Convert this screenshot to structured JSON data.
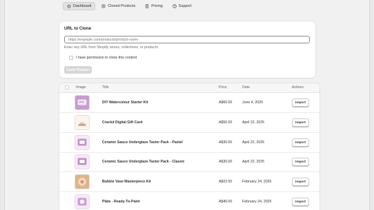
{
  "nav": {
    "tabs": [
      {
        "label": "Dashboard",
        "icon": "home-icon",
        "active": true
      },
      {
        "label": "Cloned Products",
        "icon": "products-icon",
        "active": false
      },
      {
        "label": "Pricing",
        "icon": "pricing-icon",
        "active": false
      },
      {
        "label": "Support",
        "icon": "help-icon",
        "active": false
      }
    ]
  },
  "clone_form": {
    "title": "URL to Clone",
    "url_placeholder": "https://example.com/products/product-name",
    "help_text": "Enter any URL from Shopify stores, collections, or products.",
    "permission_label": "I have permission to clone this content",
    "permission_checked": false,
    "submit_label": "Clone Product",
    "submit_disabled": true
  },
  "products_table": {
    "columns": [
      "Image",
      "Title",
      "Price",
      "Date",
      "Actions"
    ],
    "rows": [
      {
        "title": "DIY Watercolour Starter Kit",
        "price": "A$60.00",
        "date": "June 4, 2025",
        "action": "Import",
        "thumb_color": "#c99bd0"
      },
      {
        "title": "Crackd Digital Gift Card",
        "price": "A$50.00",
        "date": "April 22, 2025",
        "action": "Import",
        "thumb_color": "#d8c2a8"
      },
      {
        "title": "Ceramic Sauce Underglaze Taster Pack - Pastel",
        "price": "A$30.00",
        "date": "April 22, 2025",
        "action": "Import",
        "thumb_color": "#c494cf"
      },
      {
        "title": "Ceramic Sauce Underglaze Taster Pack - Classic",
        "price": "A$30.00",
        "date": "April 22, 2025",
        "action": "Import",
        "thumb_color": "#c28dc9"
      },
      {
        "title": "Bubble Vase Masterpiece Kit",
        "price": "A$22.50",
        "date": "February 24, 2025",
        "action": "Import",
        "thumb_color": "#e0b48a"
      },
      {
        "title": "Plate - Ready-To-Paint",
        "price": "A$40.00",
        "date": "February 24, 2025",
        "action": "Import",
        "thumb_color": "#cf9cd6"
      }
    ]
  },
  "colors": {
    "background": "#f1f1f1",
    "card": "#ffffff",
    "text": "#202223",
    "muted": "#616161",
    "disabled_button": "#d6d6d6"
  }
}
